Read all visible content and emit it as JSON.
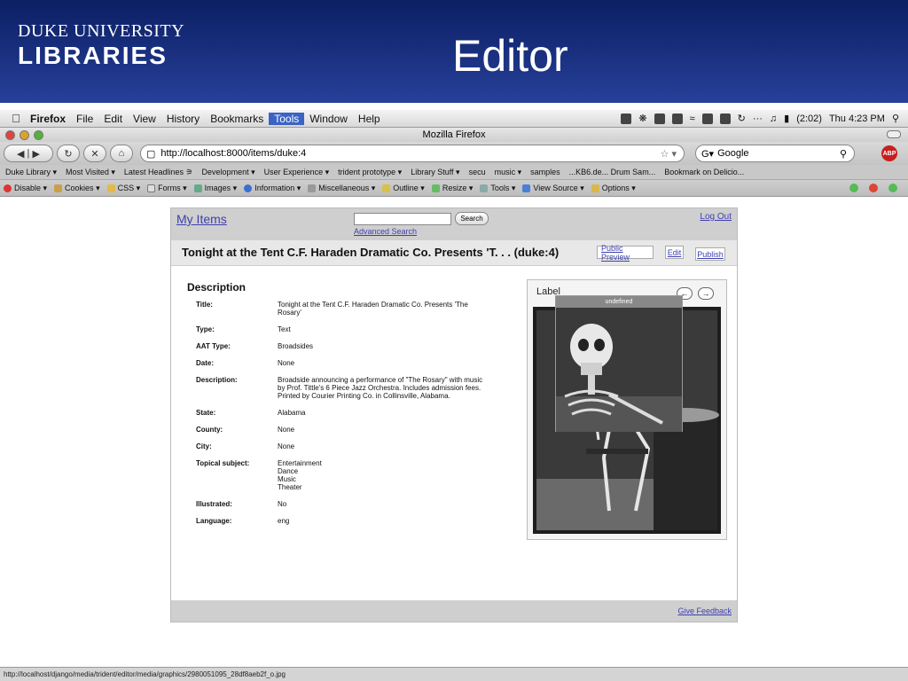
{
  "slide": {
    "logo_line1": "DUKE UNIVERSITY",
    "logo_line2": "LIBRARIES",
    "title": "Editor"
  },
  "menubar": {
    "app": "Firefox",
    "items": [
      "File",
      "Edit",
      "View",
      "History",
      "Bookmarks",
      "Tools",
      "Window",
      "Help"
    ],
    "battery": "(2:02)",
    "clock": "Thu 4:23 PM"
  },
  "window": {
    "title": "Mozilla Firefox"
  },
  "navbar": {
    "url": "http://localhost:8000/items/duke:4",
    "search_engine": "Google"
  },
  "bookmarks": [
    "Duke Library ▾",
    "Most Visited ▾",
    "Latest Headlines ⚞",
    "Development ▾",
    "User Experience ▾",
    "trident prototype ▾",
    "Library Stuff ▾",
    "secu",
    "music ▾",
    "samples",
    "...KB6.de... Drum Sam...",
    "Bookmark on Delicio..."
  ],
  "devbar": [
    "Disable ▾",
    "Cookies ▾",
    "CSS ▾",
    "Forms ▾",
    "Images ▾",
    "Information ▾",
    "Miscellaneous ▾",
    "Outline ▾",
    "Resize ▾",
    "Tools ▾",
    "View Source ▾",
    "Options ▾"
  ],
  "app": {
    "my_items": "My Items",
    "search_button": "Search",
    "advanced_search": "Advanced Search",
    "log_out": "Log Out",
    "doc_title": "Tonight at the Tent C.F. Haraden Dramatic Co. Presents 'T. . . (duke:4)",
    "public_preview": "Public Preview",
    "edit": "Edit",
    "publish": "Publish",
    "description_heading": "Description",
    "fields": [
      {
        "label": "Title:",
        "value": [
          "Tonight at the Tent C.F. Haraden Dramatic Co. Presents 'The",
          "Rosary'"
        ]
      },
      {
        "label": "Type:",
        "value": [
          "Text"
        ]
      },
      {
        "label": "AAT Type:",
        "value": [
          "Broadsides"
        ]
      },
      {
        "label": "Date:",
        "value": [
          "None"
        ]
      },
      {
        "label": "Description:",
        "value": [
          "Broadside announcing a performance of \"The Rosary\" with music",
          "by Prof. Tittle's 6 Piece Jazz Orchestra. Includes admission fees.",
          "Printed by Courier Printing Co. in Collinsville, Alabama."
        ]
      },
      {
        "label": "State:",
        "value": [
          "Alabama"
        ]
      },
      {
        "label": "County:",
        "value": [
          "None"
        ]
      },
      {
        "label": "City:",
        "value": [
          "None"
        ]
      },
      {
        "label": "Topical subject:",
        "value": [
          "Entertainment",
          "Dance",
          "Music",
          "Theater"
        ]
      },
      {
        "label": "Illustrated:",
        "value": [
          "No"
        ]
      },
      {
        "label": "Language:",
        "value": [
          "eng"
        ]
      }
    ],
    "label_panel_title": "Label",
    "side_caption": "undefined",
    "give_feedback": "Give Feedback"
  },
  "statusbar": {
    "text": "http://localhost/django/media/trident/editor/media/graphics/2980051095_28df8aeb2f_o.jpg"
  }
}
